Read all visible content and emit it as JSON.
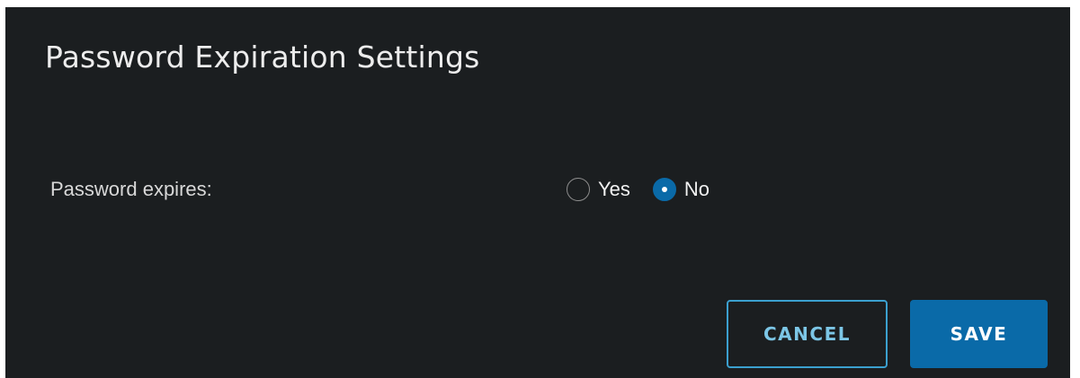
{
  "dialog": {
    "title": "Password Expiration Settings",
    "field_label": "Password expires:",
    "options": [
      {
        "label": "Yes",
        "selected": false
      },
      {
        "label": "No",
        "selected": true
      }
    ],
    "buttons": {
      "cancel_label": "CANCEL",
      "save_label": "SAVE"
    }
  },
  "colors": {
    "background": "#1b1e20",
    "accent": "#0a6aa8",
    "cancel_border": "#3ba0cf"
  }
}
